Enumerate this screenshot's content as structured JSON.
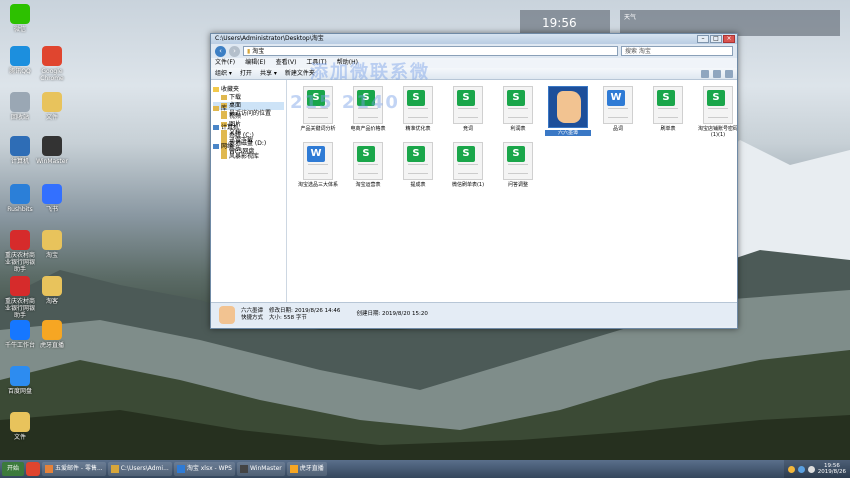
{
  "desktop": {
    "icons": [
      {
        "label": "微信",
        "color": "#2dc100"
      },
      {
        "label": "腾讯QQ",
        "color": "#1c8fde"
      },
      {
        "label": "Google Chrome",
        "color": "#e0452f"
      },
      {
        "label": "回收站",
        "color": "#9aa7b4"
      },
      {
        "label": "文件",
        "color": "#e8c35c"
      },
      {
        "label": "计算机",
        "color": "#2e6db6"
      },
      {
        "label": "WinMaster",
        "color": "#333333"
      },
      {
        "label": "Rushbits",
        "color": "#2b7fd8"
      },
      {
        "label": "飞书",
        "color": "#3370ff"
      },
      {
        "label": "重庆农村商业银行网银助手",
        "color": "#d62b2b"
      },
      {
        "label": "淘宝",
        "color": "#e8c35c"
      },
      {
        "label": "重庆农村商业银行网银助手",
        "color": "#d62b2b"
      },
      {
        "label": "淘客",
        "color": "#e8c35c"
      },
      {
        "label": "千牛工作台",
        "color": "#1677ff"
      },
      {
        "label": "虎牙直播",
        "color": "#f6a623"
      },
      {
        "label": "百度网盘",
        "color": "#2d8cf0"
      },
      {
        "label": "文件",
        "color": "#e8c35c"
      }
    ],
    "widget_left_time": "19:56",
    "widget_right_title": "天气"
  },
  "watermark": {
    "line1": "添加微联系微",
    "line2": "215 2140"
  },
  "explorer": {
    "title": "C:\\Users\\Administrator\\Desktop\\淘宝",
    "address": "淘宝",
    "search_placeholder": "搜索 淘宝",
    "menus": [
      "文件(F)",
      "编辑(E)",
      "查看(V)",
      "工具(T)",
      "帮助(H)"
    ],
    "toolbar": [
      "组织 ▾",
      "打开",
      "共享 ▾",
      "新建文件夹"
    ],
    "nav": {
      "favorites": "收藏夹",
      "fav_items": [
        "下载",
        "桌面",
        "最近访问的位置"
      ],
      "libraries": "库",
      "lib_items": [
        "视频",
        "图片",
        "文档",
        "迅雷下载",
        "音乐",
        "风暴影视库"
      ],
      "computer": "计算机",
      "comp_items": [
        "系统 (C:)",
        "本地磁盘 (D:)",
        "WPS网盘"
      ],
      "network": "网络"
    },
    "files": [
      {
        "name": "产品关键词分析",
        "type": "s"
      },
      {
        "name": "电商产品价格表",
        "type": "s"
      },
      {
        "name": "精准优化表",
        "type": "s"
      },
      {
        "name": "竞词",
        "type": "s"
      },
      {
        "name": "利润表",
        "type": "s"
      },
      {
        "name": "六六墨谭",
        "type": "img"
      },
      {
        "name": "品词",
        "type": "w"
      },
      {
        "name": "刷单表",
        "type": "s"
      },
      {
        "name": "淘宝店铺账号密码(1)(1)",
        "type": "s"
      },
      {
        "name": "淘宝选品三大体系",
        "type": "w"
      },
      {
        "name": "淘宝运营表",
        "type": "s"
      },
      {
        "name": "提成表",
        "type": "s"
      },
      {
        "name": "微信刷单表(1)",
        "type": "s"
      },
      {
        "name": "问答调整",
        "type": "s"
      }
    ],
    "details": {
      "name": "六六墨谭",
      "type": "快捷方式",
      "modified_label": "修改日期:",
      "modified": "2019/8/26 14:46",
      "size_label": "大小:",
      "size": "558 字节",
      "created_label": "创建日期:",
      "created": "2019/8/20 15:20"
    }
  },
  "taskbar": {
    "start": "开始",
    "items": [
      "五爱邮件 - 零售...",
      "C:\\Users\\Admi...",
      "淘宝 xlsx - WPS",
      "WinMaster",
      "虎牙直播"
    ],
    "clock_time": "19:56",
    "clock_date": "2019/8/26"
  }
}
